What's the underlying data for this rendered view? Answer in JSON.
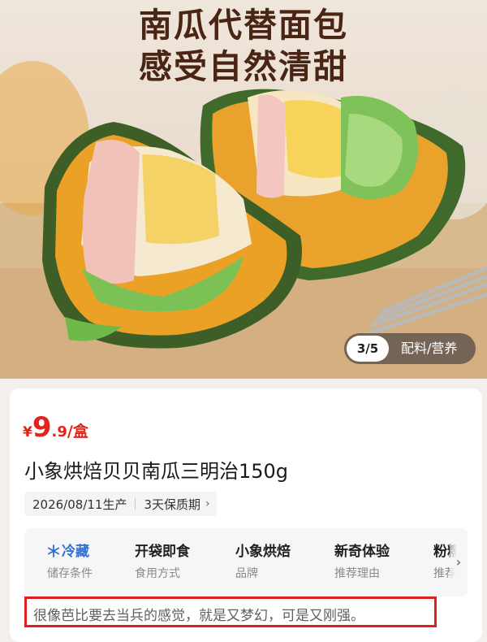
{
  "hero": {
    "title_line1": "南瓜代替面包",
    "title_line2": "感受自然清甜",
    "pager": {
      "count": "3/5",
      "label": "配料/营养"
    }
  },
  "product": {
    "price": {
      "symbol": "¥",
      "integer": "9",
      "decimal": ".9",
      "unit": "/盒"
    },
    "title": "小象烘焙贝贝南瓜三明治150g",
    "tags": {
      "production_date": "2026/08/11生产",
      "shelf_life": "3天保质期",
      "chevron": "›"
    },
    "attributes": [
      {
        "value": "冷藏",
        "label": "储存条件",
        "icon": "snowflake-icon"
      },
      {
        "value": "开袋即食",
        "label": "食用方式"
      },
      {
        "value": "小象烘焙",
        "label": "品牌"
      },
      {
        "value": "新奇体验",
        "label": "推荐理由"
      },
      {
        "value": "粉糯",
        "label": "推荐"
      }
    ],
    "attributes_more": "›",
    "comment": "很像芭比要去当兵的感觉，就是又梦幻，可是又刚强。"
  },
  "colors": {
    "price": "#e2231a",
    "storage_accent": "#2f6fd1",
    "highlight_box": "#e21e1e",
    "title_brown": "#4a2513"
  }
}
